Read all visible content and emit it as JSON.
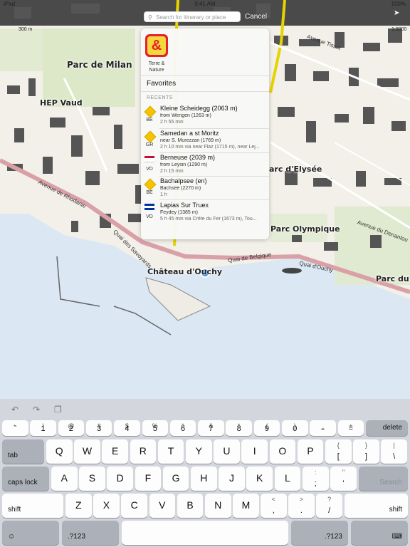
{
  "status": {
    "carrier": "iPad",
    "time": "9:41 AM",
    "battery": "100%"
  },
  "search": {
    "placeholder": "Search for itinerary or place",
    "cancel": "Cancel"
  },
  "map": {
    "scale_left": "300 m",
    "scale_right": "1:8000",
    "places": [
      {
        "name": "Parc de Milan",
        "size": 12
      },
      {
        "name": "HEP Vaud",
        "size": 11
      },
      {
        "name": "Château d'Ouchy",
        "size": 11
      },
      {
        "name": "Parc Olympique",
        "size": 11
      },
      {
        "name": "Parc du D",
        "size": 11
      }
    ],
    "streets": [
      "Avenue de Cour",
      "Avenue de Rhodanie",
      "Quai de Belgique",
      "Quai d'Ouchy",
      "Chemin de Bellerive",
      "Quai des Savoyards",
      "Avenue Tissot",
      "Avenue de Montchoisi",
      "Avenue du Denantou",
      "Avenue Fantaisie",
      "Avenue de l'Elysée",
      "Rue du Lac"
    ]
  },
  "panel": {
    "app_logo": "&",
    "app_name": "Terre & Nature",
    "favorites": "Favorites",
    "recents_label": "RECENTS",
    "recents": [
      {
        "badge": "diamond-yellow",
        "canton": "BE",
        "title": "Kleine Scheidegg (2063 m)",
        "sub": "from Wengen (1263 m)",
        "sub2": "2 h 55 min"
      },
      {
        "badge": "diamond-yellow",
        "canton": "GR",
        "title": "Samedan a st Moritz",
        "sub": "near S. Murezzan (1769 m)",
        "sub2": "2 h 10 min  via near Flaz (1715 m), near Lej..."
      },
      {
        "badge": "flag-red",
        "canton": "VD",
        "title": "Berneuse (2039 m)",
        "sub": "from Leysin (1290 m)",
        "sub2": "2 h 15 min"
      },
      {
        "badge": "diamond-yellow",
        "canton": "BE",
        "title": "Bachalpsee (en)",
        "sub": "Bachsee (2270 m)",
        "sub2": "1 h"
      },
      {
        "badge": "flag-blue",
        "canton": "VD",
        "title": "Lapias Sur Truex",
        "sub": "Feydey (1385 m)",
        "sub2": "5 h 45 min  via Crête du Fer (1673 m), Tou..."
      }
    ]
  },
  "keyboard": {
    "row1": [
      {
        "top": "~",
        "bot": "`"
      },
      {
        "top": "!",
        "bot": "1"
      },
      {
        "top": "@",
        "bot": "2"
      },
      {
        "top": "#",
        "bot": "3"
      },
      {
        "top": "$",
        "bot": "4"
      },
      {
        "top": "%",
        "bot": "5"
      },
      {
        "top": "^",
        "bot": "6"
      },
      {
        "top": "&",
        "bot": "7"
      },
      {
        "top": "*",
        "bot": "8"
      },
      {
        "top": "(",
        "bot": "9"
      },
      {
        "top": ")",
        "bot": "0"
      },
      {
        "top": "_",
        "bot": "-"
      },
      {
        "top": "+",
        "bot": "="
      }
    ],
    "delete": "delete",
    "tab": "tab",
    "row2": [
      "Q",
      "W",
      "E",
      "R",
      "T",
      "Y",
      "U",
      "I",
      "O",
      "P"
    ],
    "row2_extra": [
      {
        "top": "{",
        "bot": "["
      },
      {
        "top": "}",
        "bot": "]"
      },
      {
        "top": "|",
        "bot": "\\"
      }
    ],
    "caps": "caps lock",
    "row3": [
      "A",
      "S",
      "D",
      "F",
      "G",
      "H",
      "J",
      "K",
      "L"
    ],
    "row3_extra": [
      {
        "top": ":",
        "bot": ";"
      },
      {
        "top": "\"",
        "bot": "'"
      }
    ],
    "search_key": "Search",
    "shift": "shift",
    "row4": [
      "Z",
      "X",
      "C",
      "V",
      "B",
      "N",
      "M"
    ],
    "row4_extra": [
      {
        "top": "<",
        "bot": ","
      },
      {
        "top": ">",
        "bot": "."
      },
      {
        "top": "?",
        "bot": "/"
      }
    ],
    "emoji": "☺",
    "numbers": ".?123",
    "hide": "⌨"
  }
}
